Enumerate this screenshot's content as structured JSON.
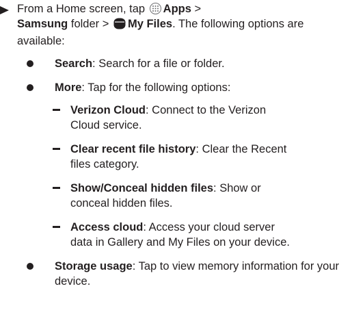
{
  "step": {
    "prefix": "From a Home screen, tap",
    "apps_label": "Apps",
    "separator1": ">",
    "samsung_label": "Samsung",
    "folder_text": "folder >",
    "myfiles_label": "My Files",
    "suffix": ". The following options are available:"
  },
  "options": [
    {
      "term": "Search",
      "desc": ": Search for a file or folder."
    },
    {
      "term": "More",
      "desc": ": Tap for the following options:"
    },
    {
      "term": "Storage usage",
      "desc": ": Tap to view memory information for your device."
    }
  ],
  "more_options": [
    {
      "term": "Verizon Cloud",
      "desc": ": Connect to the Verizon Cloud service."
    },
    {
      "term": "Clear recent file history",
      "desc": ": Clear the Recent files category."
    },
    {
      "term": "Show/Conceal hidden files",
      "desc": ": Show or conceal hidden files."
    },
    {
      "term": "Access cloud",
      "desc": ": Access your cloud server data in Gallery and My Files on your device."
    }
  ]
}
